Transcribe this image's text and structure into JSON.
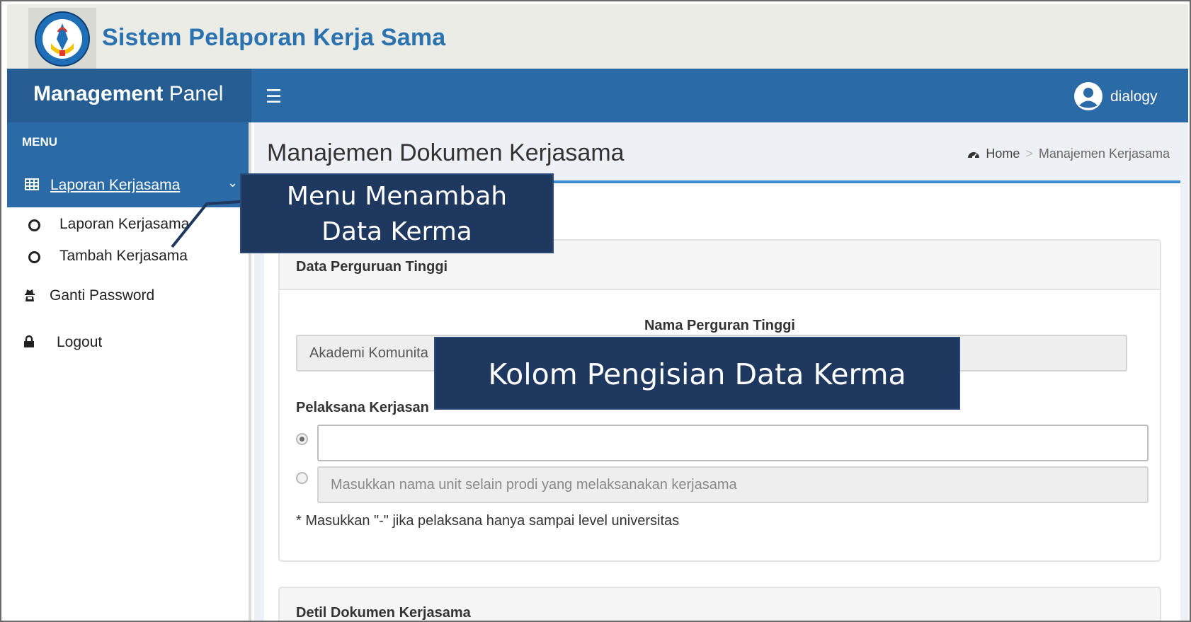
{
  "banner": {
    "title": "Sistem Pelaporan Kerja Sama",
    "logo_text": "TUT WURI HANDAYANI"
  },
  "header": {
    "brand_bold": "Management",
    "brand_rest": " Panel",
    "menu_icon": "hamburger-icon",
    "user": "dialogy"
  },
  "sidebar": {
    "menu_label": "MENU",
    "active_item": "Laporan Kerjasama",
    "sub_items": [
      "Laporan Kerjasama",
      "Tambah Kerjasama"
    ],
    "items": [
      {
        "label": "Ganti Password",
        "icon": "user-secret-icon"
      },
      {
        "label": "Logout",
        "icon": "lock-icon"
      }
    ]
  },
  "page": {
    "title": "Manajemen Dokumen Kerjasama",
    "breadcrumb": {
      "home": "Home",
      "sep": ">",
      "current": "Manajemen Kerjasama"
    }
  },
  "form": {
    "section1_title": "Data Perguruan Tinggi",
    "nama_label": "Nama Perguran Tinggi",
    "nama_value": "Akademi Komunita",
    "pelaksana_label": "Pelaksana Kerjasan",
    "unit_placeholder": "Masukkan nama unit selain prodi yang melaksanakan kerjasama",
    "hint": "* Masukkan \"-\" jika pelaksana hanya sampai level universitas",
    "section2_title": "Detil Dokumen Kerjasama"
  },
  "annotations": {
    "menu_line1": "Menu Menambah",
    "menu_line2": "Data Kerma",
    "kolom": "Kolom Pengisian Data Kerma"
  },
  "colors": {
    "brand_blue": "#2a6aa6",
    "sidebar_head": "#255c91",
    "callout": "#1f3860",
    "title_blue": "#2b73b0"
  }
}
